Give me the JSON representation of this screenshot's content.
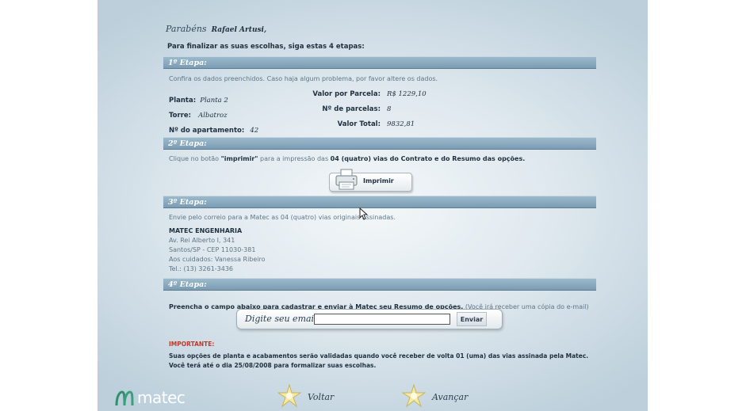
{
  "header": {
    "greeting": "Parabéns",
    "user_name": "Rafael Artusi,",
    "intro": "Para finalizar as suas escolhas, siga estas 4 etapas:"
  },
  "step1": {
    "title": "1º Etapa:",
    "instruction": "Confira os dados preenchidos. Caso haja algum problema, por favor altere os dados.",
    "fields": [
      {
        "label": "Planta:",
        "value": "Planta 2"
      },
      {
        "label": "Torre:",
        "value": "Albatroz"
      },
      {
        "label": "Nº do apartamento:",
        "value": "42"
      },
      {
        "label": "Valor por Parcela:",
        "value": "R$ 1229,10"
      },
      {
        "label": "Nº de parcelas:",
        "value": "8"
      },
      {
        "label": "Valor Total:",
        "value": "9832,81"
      }
    ]
  },
  "step2": {
    "title": "2º Etapa:",
    "text_a": "Clique no botão ",
    "text_b": "\"imprimir\"",
    "text_c": " para a impressão das ",
    "text_d": "04 (quatro) vias do Contrato e do Resumo das opções.",
    "print_label": "Imprimir"
  },
  "step3": {
    "title": "3º Etapa:",
    "instruction": "Envie pelo correio para a Matec as 04 (quatro) vias originais assinadas.",
    "address": {
      "company": "MATEC ENGENHARIA",
      "street": "Av. Rei Alberto I, 341",
      "city": "Santos/SP - CEP 11030-381",
      "attention": "Aos cuidados: Vanessa Ribeiro",
      "phone": "Tel.: (13) 3261-3436"
    }
  },
  "step4": {
    "title": "4º Etapa:",
    "instruction_bold": "Preencha o campo abaixo para cadastrar e enviar à Matec seu Resumo de opções.",
    "instruction_note": " (Você irá receber uma cópia do e-mail)",
    "email_label": "Digite seu email:",
    "email_value": "",
    "send_label": "Enviar"
  },
  "footer_notes": {
    "important_label": "IMPORTANTE:",
    "line1": "Suas opções de planta e acabamentos serão validadas quando você receber de volta 01 (uma) das vias assinada pela Matec.",
    "line2": "Você terá até o dia 25/08/2008 para formalizar suas escolhas."
  },
  "nav": {
    "back_label": "Voltar",
    "next_label": "Avançar"
  },
  "brand": {
    "name": "matec",
    "accent_color": "#7a9cb3",
    "important_color": "#c0392b"
  },
  "icons": [
    "printer-icon",
    "star-icon",
    "matec-logo-icon",
    "mouse-cursor-icon"
  ]
}
